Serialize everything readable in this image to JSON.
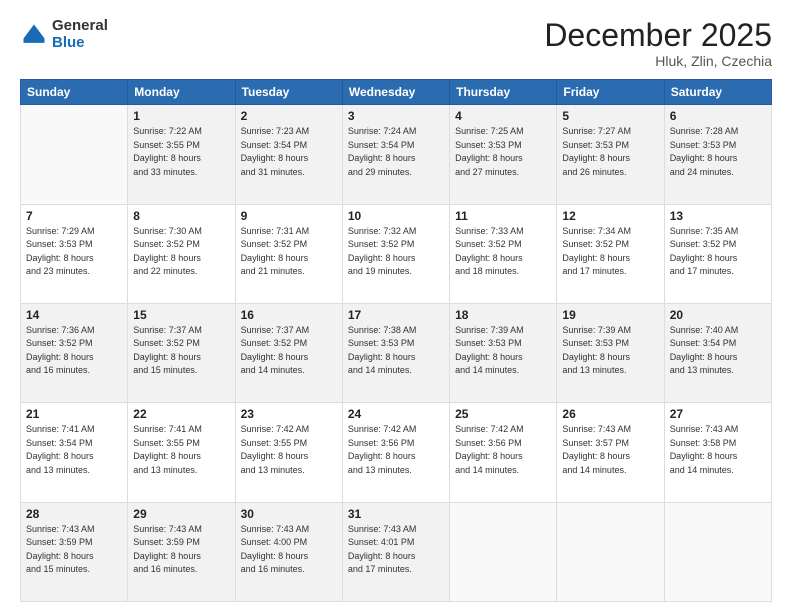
{
  "logo": {
    "general": "General",
    "blue": "Blue"
  },
  "header": {
    "month": "December 2025",
    "location": "Hluk, Zlin, Czechia"
  },
  "days_of_week": [
    "Sunday",
    "Monday",
    "Tuesday",
    "Wednesday",
    "Thursday",
    "Friday",
    "Saturday"
  ],
  "weeks": [
    [
      {
        "day": "",
        "info": ""
      },
      {
        "day": "1",
        "info": "Sunrise: 7:22 AM\nSunset: 3:55 PM\nDaylight: 8 hours\nand 33 minutes."
      },
      {
        "day": "2",
        "info": "Sunrise: 7:23 AM\nSunset: 3:54 PM\nDaylight: 8 hours\nand 31 minutes."
      },
      {
        "day": "3",
        "info": "Sunrise: 7:24 AM\nSunset: 3:54 PM\nDaylight: 8 hours\nand 29 minutes."
      },
      {
        "day": "4",
        "info": "Sunrise: 7:25 AM\nSunset: 3:53 PM\nDaylight: 8 hours\nand 27 minutes."
      },
      {
        "day": "5",
        "info": "Sunrise: 7:27 AM\nSunset: 3:53 PM\nDaylight: 8 hours\nand 26 minutes."
      },
      {
        "day": "6",
        "info": "Sunrise: 7:28 AM\nSunset: 3:53 PM\nDaylight: 8 hours\nand 24 minutes."
      }
    ],
    [
      {
        "day": "7",
        "info": "Sunrise: 7:29 AM\nSunset: 3:53 PM\nDaylight: 8 hours\nand 23 minutes."
      },
      {
        "day": "8",
        "info": "Sunrise: 7:30 AM\nSunset: 3:52 PM\nDaylight: 8 hours\nand 22 minutes."
      },
      {
        "day": "9",
        "info": "Sunrise: 7:31 AM\nSunset: 3:52 PM\nDaylight: 8 hours\nand 21 minutes."
      },
      {
        "day": "10",
        "info": "Sunrise: 7:32 AM\nSunset: 3:52 PM\nDaylight: 8 hours\nand 19 minutes."
      },
      {
        "day": "11",
        "info": "Sunrise: 7:33 AM\nSunset: 3:52 PM\nDaylight: 8 hours\nand 18 minutes."
      },
      {
        "day": "12",
        "info": "Sunrise: 7:34 AM\nSunset: 3:52 PM\nDaylight: 8 hours\nand 17 minutes."
      },
      {
        "day": "13",
        "info": "Sunrise: 7:35 AM\nSunset: 3:52 PM\nDaylight: 8 hours\nand 17 minutes."
      }
    ],
    [
      {
        "day": "14",
        "info": "Sunrise: 7:36 AM\nSunset: 3:52 PM\nDaylight: 8 hours\nand 16 minutes."
      },
      {
        "day": "15",
        "info": "Sunrise: 7:37 AM\nSunset: 3:52 PM\nDaylight: 8 hours\nand 15 minutes."
      },
      {
        "day": "16",
        "info": "Sunrise: 7:37 AM\nSunset: 3:52 PM\nDaylight: 8 hours\nand 14 minutes."
      },
      {
        "day": "17",
        "info": "Sunrise: 7:38 AM\nSunset: 3:53 PM\nDaylight: 8 hours\nand 14 minutes."
      },
      {
        "day": "18",
        "info": "Sunrise: 7:39 AM\nSunset: 3:53 PM\nDaylight: 8 hours\nand 14 minutes."
      },
      {
        "day": "19",
        "info": "Sunrise: 7:39 AM\nSunset: 3:53 PM\nDaylight: 8 hours\nand 13 minutes."
      },
      {
        "day": "20",
        "info": "Sunrise: 7:40 AM\nSunset: 3:54 PM\nDaylight: 8 hours\nand 13 minutes."
      }
    ],
    [
      {
        "day": "21",
        "info": "Sunrise: 7:41 AM\nSunset: 3:54 PM\nDaylight: 8 hours\nand 13 minutes."
      },
      {
        "day": "22",
        "info": "Sunrise: 7:41 AM\nSunset: 3:55 PM\nDaylight: 8 hours\nand 13 minutes."
      },
      {
        "day": "23",
        "info": "Sunrise: 7:42 AM\nSunset: 3:55 PM\nDaylight: 8 hours\nand 13 minutes."
      },
      {
        "day": "24",
        "info": "Sunrise: 7:42 AM\nSunset: 3:56 PM\nDaylight: 8 hours\nand 13 minutes."
      },
      {
        "day": "25",
        "info": "Sunrise: 7:42 AM\nSunset: 3:56 PM\nDaylight: 8 hours\nand 14 minutes."
      },
      {
        "day": "26",
        "info": "Sunrise: 7:43 AM\nSunset: 3:57 PM\nDaylight: 8 hours\nand 14 minutes."
      },
      {
        "day": "27",
        "info": "Sunrise: 7:43 AM\nSunset: 3:58 PM\nDaylight: 8 hours\nand 14 minutes."
      }
    ],
    [
      {
        "day": "28",
        "info": "Sunrise: 7:43 AM\nSunset: 3:59 PM\nDaylight: 8 hours\nand 15 minutes."
      },
      {
        "day": "29",
        "info": "Sunrise: 7:43 AM\nSunset: 3:59 PM\nDaylight: 8 hours\nand 16 minutes."
      },
      {
        "day": "30",
        "info": "Sunrise: 7:43 AM\nSunset: 4:00 PM\nDaylight: 8 hours\nand 16 minutes."
      },
      {
        "day": "31",
        "info": "Sunrise: 7:43 AM\nSunset: 4:01 PM\nDaylight: 8 hours\nand 17 minutes."
      },
      {
        "day": "",
        "info": ""
      },
      {
        "day": "",
        "info": ""
      },
      {
        "day": "",
        "info": ""
      }
    ]
  ],
  "row_styles": [
    "shaded",
    "white",
    "shaded",
    "white",
    "shaded"
  ]
}
